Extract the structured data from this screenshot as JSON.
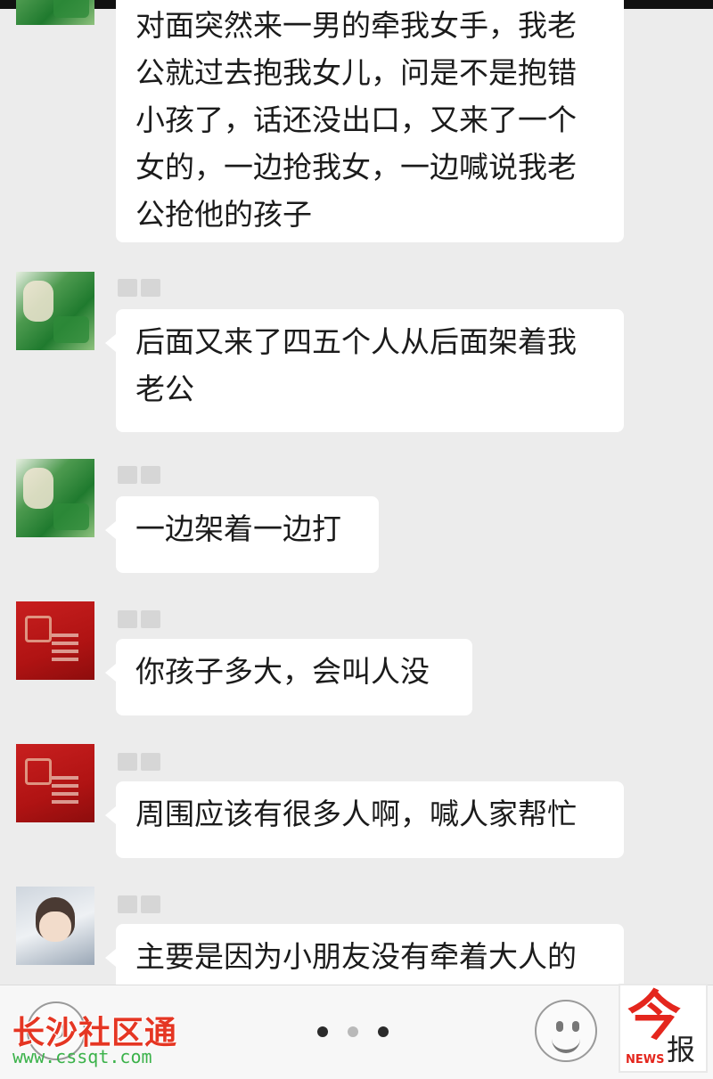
{
  "messages": [
    {
      "avatar_icon": "green-avatar-icon",
      "text": "对面突然来一男的牵我女手，我老公就过去抱我女儿，问是不是抱错小孩了，话还没出口，又来了一个女的，一边抢我女，一边喊说我老公抢他的孩子"
    },
    {
      "avatar_icon": "green-avatar-icon",
      "text": "后面又来了四五个人从后面架着我老公"
    },
    {
      "avatar_icon": "green-avatar-icon",
      "text": "一边架着一边打"
    },
    {
      "avatar_icon": "red-avatar-icon",
      "text": "你孩子多大，会叫人没"
    },
    {
      "avatar_icon": "red-avatar-icon",
      "text": "周围应该有很多人啊，喊人家帮忙"
    },
    {
      "avatar_icon": "person-avatar-icon",
      "text": "主要是因为小朋友没有牵着大人的"
    }
  ],
  "bottom_bar": {
    "voice_icon": "voice-icon",
    "emoji_icon": "emoji-icon",
    "page_dots": 3,
    "active_dot": 0
  },
  "watermark": {
    "title": "长沙社区通",
    "url": "www.cssqt.com"
  },
  "logo": {
    "glyph": "今",
    "sub": "报",
    "news": "NEWS"
  },
  "colors": {
    "background": "#ececec",
    "bubble": "#ffffff",
    "watermark_red": "#e53623",
    "watermark_green": "#3bb24a",
    "logo_red": "#e4261d"
  }
}
